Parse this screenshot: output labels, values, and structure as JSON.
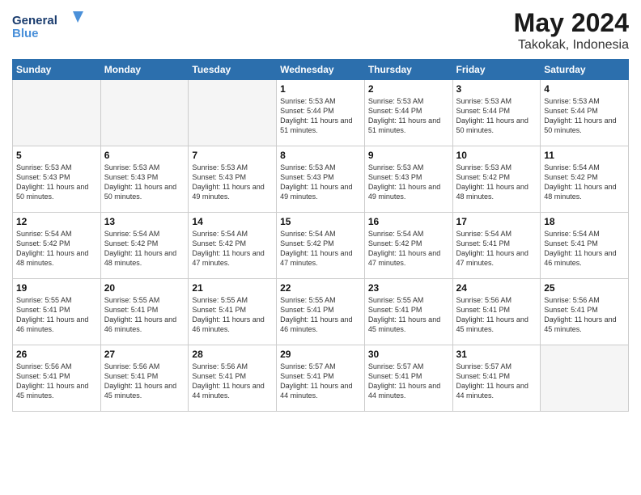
{
  "header": {
    "logo_line1": "General",
    "logo_line2": "Blue",
    "month": "May 2024",
    "location": "Takokak, Indonesia"
  },
  "days_of_week": [
    "Sunday",
    "Monday",
    "Tuesday",
    "Wednesday",
    "Thursday",
    "Friday",
    "Saturday"
  ],
  "weeks": [
    [
      {
        "day": "",
        "empty": true
      },
      {
        "day": "",
        "empty": true
      },
      {
        "day": "",
        "empty": true
      },
      {
        "day": "1",
        "sunrise": "5:53 AM",
        "sunset": "5:44 PM",
        "daylight": "11 hours and 51 minutes."
      },
      {
        "day": "2",
        "sunrise": "5:53 AM",
        "sunset": "5:44 PM",
        "daylight": "11 hours and 51 minutes."
      },
      {
        "day": "3",
        "sunrise": "5:53 AM",
        "sunset": "5:44 PM",
        "daylight": "11 hours and 50 minutes."
      },
      {
        "day": "4",
        "sunrise": "5:53 AM",
        "sunset": "5:44 PM",
        "daylight": "11 hours and 50 minutes."
      }
    ],
    [
      {
        "day": "5",
        "sunrise": "5:53 AM",
        "sunset": "5:43 PM",
        "daylight": "11 hours and 50 minutes."
      },
      {
        "day": "6",
        "sunrise": "5:53 AM",
        "sunset": "5:43 PM",
        "daylight": "11 hours and 50 minutes."
      },
      {
        "day": "7",
        "sunrise": "5:53 AM",
        "sunset": "5:43 PM",
        "daylight": "11 hours and 49 minutes."
      },
      {
        "day": "8",
        "sunrise": "5:53 AM",
        "sunset": "5:43 PM",
        "daylight": "11 hours and 49 minutes."
      },
      {
        "day": "9",
        "sunrise": "5:53 AM",
        "sunset": "5:43 PM",
        "daylight": "11 hours and 49 minutes."
      },
      {
        "day": "10",
        "sunrise": "5:53 AM",
        "sunset": "5:42 PM",
        "daylight": "11 hours and 48 minutes."
      },
      {
        "day": "11",
        "sunrise": "5:54 AM",
        "sunset": "5:42 PM",
        "daylight": "11 hours and 48 minutes."
      }
    ],
    [
      {
        "day": "12",
        "sunrise": "5:54 AM",
        "sunset": "5:42 PM",
        "daylight": "11 hours and 48 minutes."
      },
      {
        "day": "13",
        "sunrise": "5:54 AM",
        "sunset": "5:42 PM",
        "daylight": "11 hours and 48 minutes."
      },
      {
        "day": "14",
        "sunrise": "5:54 AM",
        "sunset": "5:42 PM",
        "daylight": "11 hours and 47 minutes."
      },
      {
        "day": "15",
        "sunrise": "5:54 AM",
        "sunset": "5:42 PM",
        "daylight": "11 hours and 47 minutes."
      },
      {
        "day": "16",
        "sunrise": "5:54 AM",
        "sunset": "5:42 PM",
        "daylight": "11 hours and 47 minutes."
      },
      {
        "day": "17",
        "sunrise": "5:54 AM",
        "sunset": "5:41 PM",
        "daylight": "11 hours and 47 minutes."
      },
      {
        "day": "18",
        "sunrise": "5:54 AM",
        "sunset": "5:41 PM",
        "daylight": "11 hours and 46 minutes."
      }
    ],
    [
      {
        "day": "19",
        "sunrise": "5:55 AM",
        "sunset": "5:41 PM",
        "daylight": "11 hours and 46 minutes."
      },
      {
        "day": "20",
        "sunrise": "5:55 AM",
        "sunset": "5:41 PM",
        "daylight": "11 hours and 46 minutes."
      },
      {
        "day": "21",
        "sunrise": "5:55 AM",
        "sunset": "5:41 PM",
        "daylight": "11 hours and 46 minutes."
      },
      {
        "day": "22",
        "sunrise": "5:55 AM",
        "sunset": "5:41 PM",
        "daylight": "11 hours and 46 minutes."
      },
      {
        "day": "23",
        "sunrise": "5:55 AM",
        "sunset": "5:41 PM",
        "daylight": "11 hours and 45 minutes."
      },
      {
        "day": "24",
        "sunrise": "5:56 AM",
        "sunset": "5:41 PM",
        "daylight": "11 hours and 45 minutes."
      },
      {
        "day": "25",
        "sunrise": "5:56 AM",
        "sunset": "5:41 PM",
        "daylight": "11 hours and 45 minutes."
      }
    ],
    [
      {
        "day": "26",
        "sunrise": "5:56 AM",
        "sunset": "5:41 PM",
        "daylight": "11 hours and 45 minutes."
      },
      {
        "day": "27",
        "sunrise": "5:56 AM",
        "sunset": "5:41 PM",
        "daylight": "11 hours and 45 minutes."
      },
      {
        "day": "28",
        "sunrise": "5:56 AM",
        "sunset": "5:41 PM",
        "daylight": "11 hours and 44 minutes."
      },
      {
        "day": "29",
        "sunrise": "5:57 AM",
        "sunset": "5:41 PM",
        "daylight": "11 hours and 44 minutes."
      },
      {
        "day": "30",
        "sunrise": "5:57 AM",
        "sunset": "5:41 PM",
        "daylight": "11 hours and 44 minutes."
      },
      {
        "day": "31",
        "sunrise": "5:57 AM",
        "sunset": "5:41 PM",
        "daylight": "11 hours and 44 minutes."
      },
      {
        "day": "",
        "empty": true
      }
    ]
  ]
}
